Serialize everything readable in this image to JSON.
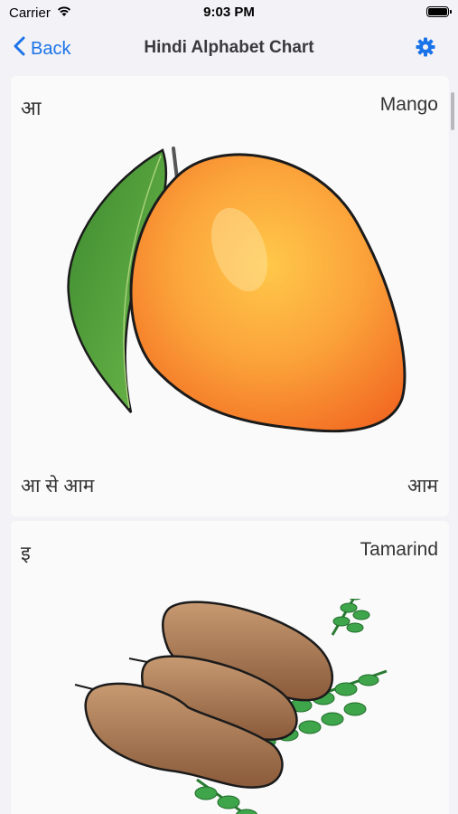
{
  "status": {
    "carrier": "Carrier",
    "time": "9:03 PM"
  },
  "nav": {
    "back_label": "Back",
    "title": "Hindi Alphabet Chart"
  },
  "cards": [
    {
      "letter": "आ",
      "name": "Mango",
      "phrase": "आ से आम",
      "word": "आम",
      "image": "mango-illustration"
    },
    {
      "letter": "इ",
      "name": "Tamarind",
      "image": "tamarind-illustration"
    }
  ],
  "colors": {
    "accent": "#1a73e8",
    "background": "#f2f2f7",
    "card": "#fafafa"
  }
}
